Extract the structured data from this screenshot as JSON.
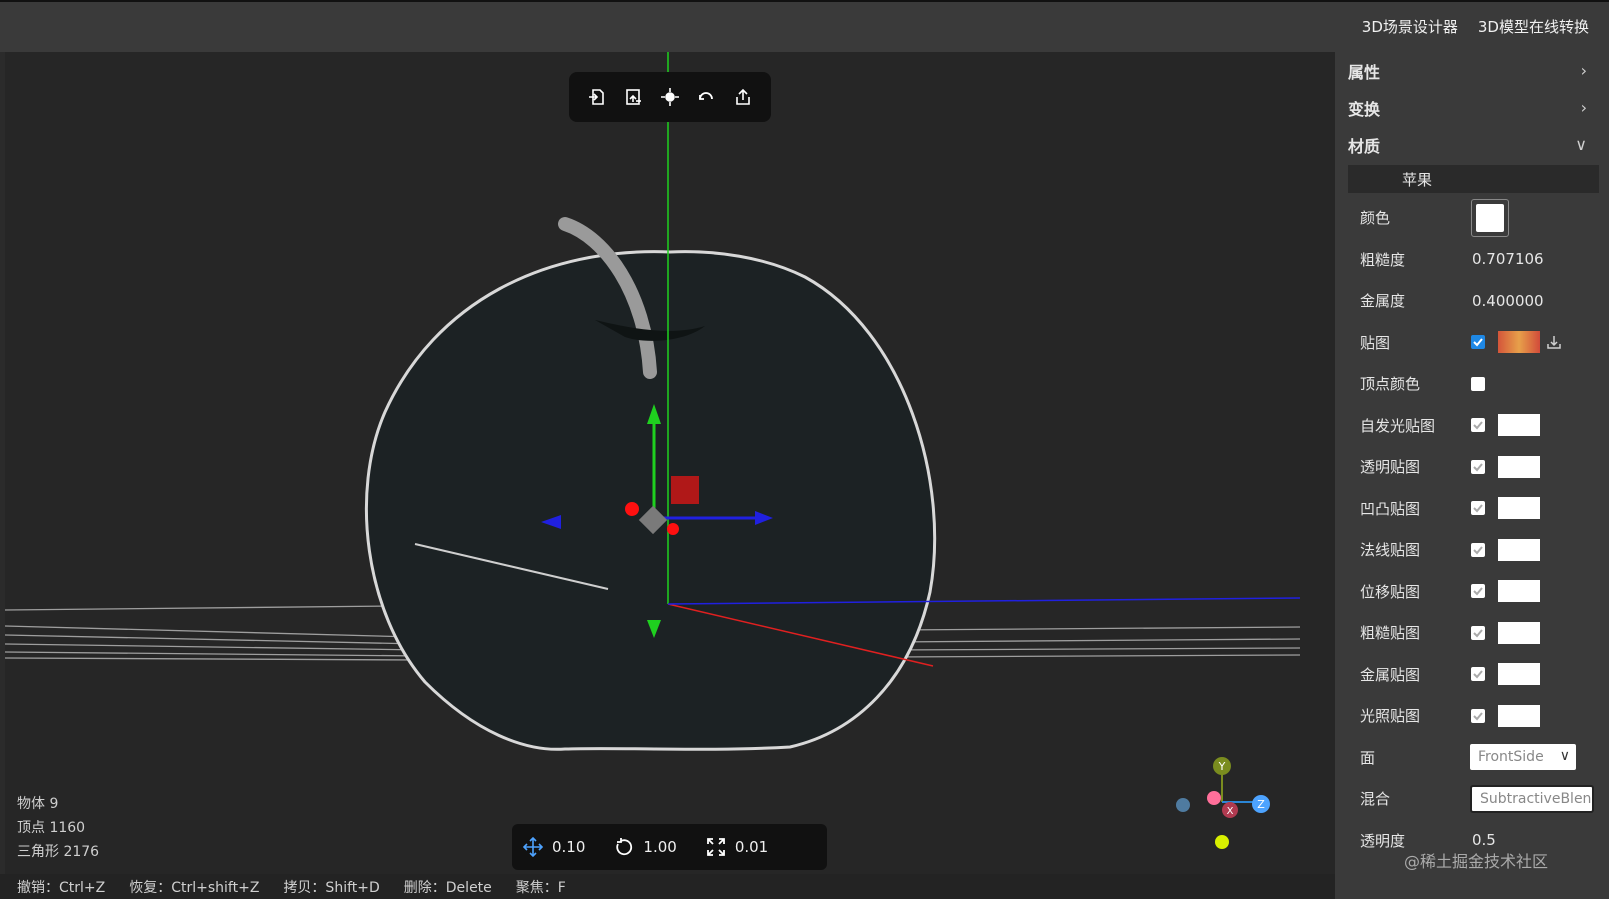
{
  "header": {
    "menu": [
      "3D场景设计器",
      "3D模型在线转换"
    ]
  },
  "toolbar": {
    "icons": [
      "import-icon",
      "export-model-icon",
      "focus-icon",
      "reset-icon",
      "share-icon"
    ]
  },
  "stats": {
    "objects": "物体 9",
    "vertices": "顶点 1160",
    "triangles": "三角形 2176"
  },
  "snap": {
    "translate": "0.10",
    "rotate": "1.00",
    "scale": "0.01"
  },
  "shortcuts": [
    "撤销：Ctrl+Z",
    "恢复：Ctrl+shift+Z",
    "拷贝：Shift+D",
    "删除：Delete",
    "聚焦：F"
  ],
  "gizmo": {
    "y": "Y",
    "z": "Z",
    "x": "X"
  },
  "panel": {
    "sections": {
      "properties": "属性",
      "transform": "变换",
      "material": "材质"
    },
    "material_tab": "苹果",
    "rows": {
      "color": "颜色",
      "roughness": "粗糙度",
      "roughness_value": "0.707106",
      "metalness": "金属度",
      "metalness_value": "0.400000",
      "map": "贴图",
      "vertex_colors": "顶点颜色",
      "emissive_map": "自发光贴图",
      "alpha_map": "透明贴图",
      "bump_map": "凹凸贴图",
      "normal_map": "法线贴图",
      "displacement_map": "位移贴图",
      "roughness_map": "粗糙贴图",
      "metalness_map": "金属贴图",
      "light_map": "光照贴图",
      "side": "面",
      "side_value": "FrontSide",
      "blending": "混合",
      "blending_value": "SubtractiveBlend",
      "opacity": "透明度",
      "opacity_value": "0.5"
    }
  },
  "watermark": "@稀土掘金技术社区",
  "colors": {
    "axis_x": "#e02020",
    "axis_y": "#1fd11f",
    "axis_z": "#2020e0",
    "accent": "#1e88e5"
  }
}
